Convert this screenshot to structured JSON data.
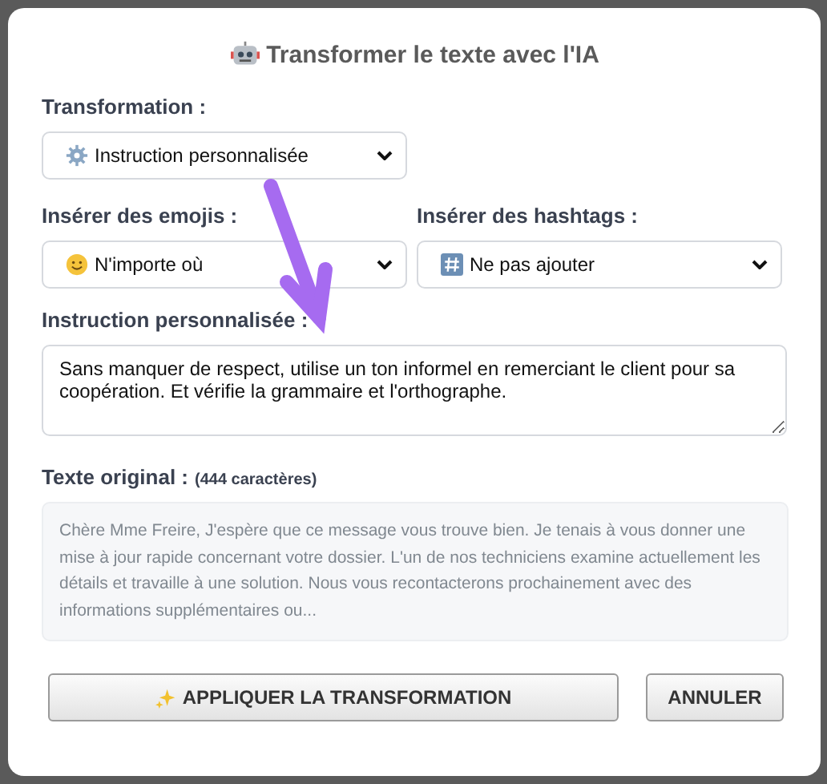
{
  "dialog": {
    "title": "Transformer le texte avec l'IA"
  },
  "transformation": {
    "label": "Transformation :",
    "value": "Instruction personnalisée"
  },
  "emojis": {
    "label": "Insérer des emojis :",
    "value": "N'importe où"
  },
  "hashtags": {
    "label": "Insérer des hashtags :",
    "value": "Ne pas ajouter"
  },
  "instruction": {
    "label": "Instruction personnalisée :",
    "value": "Sans manquer de respect, utilise un ton informel en remerciant le client pour sa coopération. Et vérifie la grammaire et l'orthographe."
  },
  "original": {
    "label": "Texte original :",
    "count": "(444 caractères)",
    "text": "Chère Mme Freire, J'espère que ce message vous trouve bien. Je tenais à vous donner une mise à jour rapide concernant votre dossier. L'un de nos techniciens examine actuellement les détails et travaille à une solution. Nous vous recontacterons prochainement avec des informations supplémentaires ou..."
  },
  "buttons": {
    "apply": "APPLIQUER LA TRANSFORMATION",
    "cancel": "ANNULER"
  }
}
